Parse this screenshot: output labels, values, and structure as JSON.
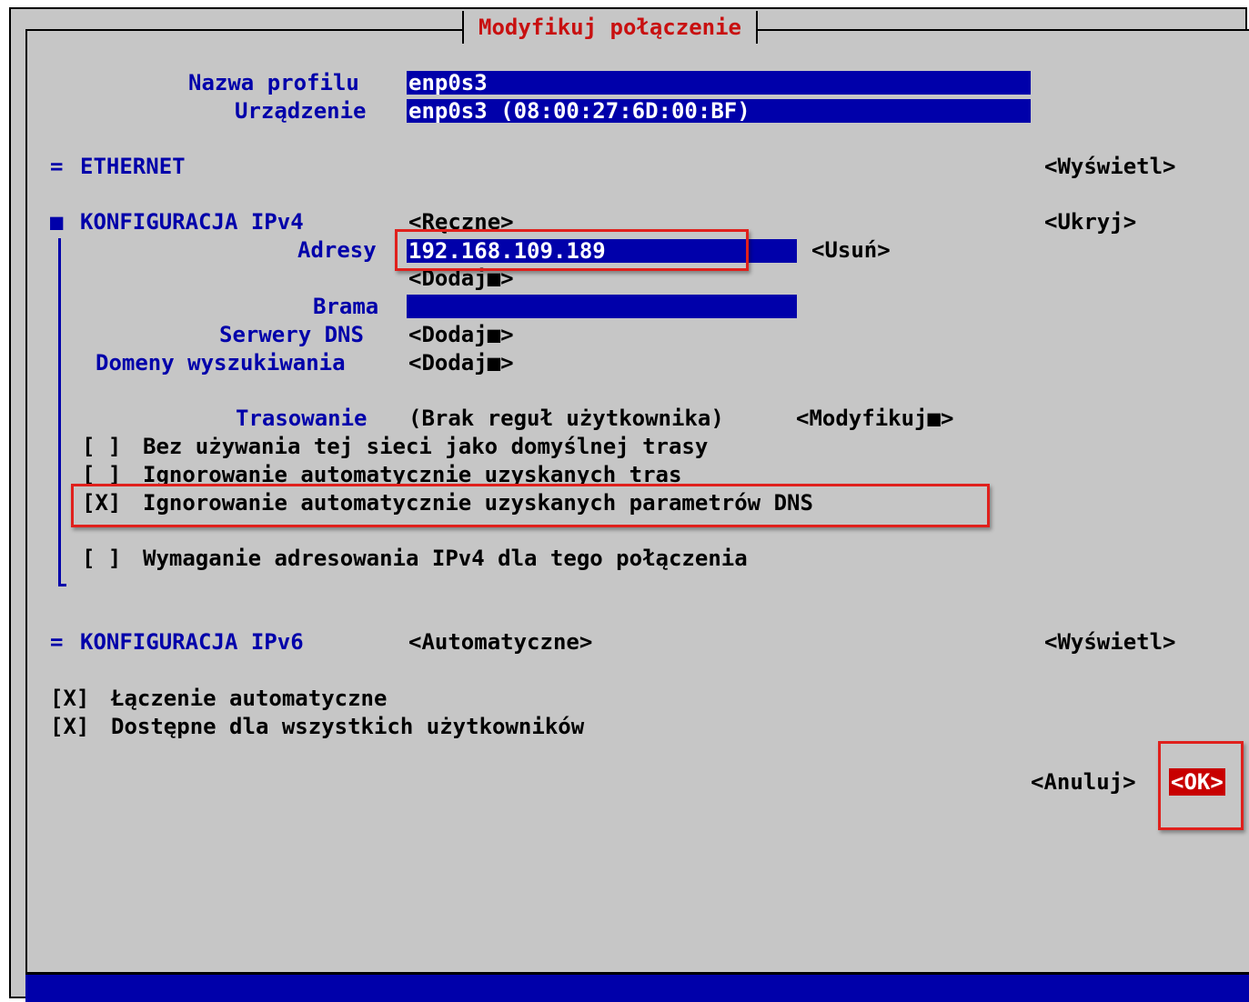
{
  "dialog": {
    "title": "Modyfikuj połączenie"
  },
  "profile": {
    "name_label": "Nazwa profilu",
    "name_value": "enp0s3",
    "device_label": "Urządzenie",
    "device_value": "enp0s3 (08:00:27:6D:00:BF)"
  },
  "ethernet": {
    "marker": "=",
    "label": "ETHERNET",
    "toggle": "<Wyświetl>"
  },
  "ipv4": {
    "marker": "■",
    "label": "KONFIGURACJA IPv4",
    "mode": "<Ręczne>",
    "toggle": "<Ukryj>",
    "addresses_label": "Adresy",
    "address_value": "192.168.109.189",
    "remove_button": "<Usuń>",
    "add_address": "<Dodaj■>",
    "gateway_label": "Brama",
    "gateway_value": "",
    "dns_label": "Serwery DNS",
    "dns_add": "<Dodaj■>",
    "search_label": "Domeny wyszukiwania",
    "search_add": "<Dodaj■>",
    "routing_label": "Trasowanie",
    "routing_value": "(Brak reguł użytkownika)",
    "routing_modify": "<Modyfikuj■>",
    "checkboxes": [
      {
        "mark": "[ ]",
        "label": "Bez używania tej sieci jako domyślnej trasy"
      },
      {
        "mark": "[ ]",
        "label": "Ignorowanie automatycznie uzyskanych tras"
      },
      {
        "mark": "[X]",
        "label": "Ignorowanie automatycznie uzyskanych parametrów DNS"
      },
      {
        "mark": "[ ]",
        "label": "Wymaganie adresowania IPv4 dla tego połączenia"
      }
    ]
  },
  "ipv6": {
    "marker": "=",
    "label": "KONFIGURACJA IPv6",
    "mode": "<Automatyczne>",
    "toggle": "<Wyświetl>"
  },
  "options": [
    {
      "mark": "[X]",
      "label": "Łączenie automatyczne"
    },
    {
      "mark": "[X]",
      "label": "Dostępne dla wszystkich użytkowników"
    }
  ],
  "buttons": {
    "cancel": "<Anuluj>",
    "ok": "<OK>"
  },
  "colors": {
    "accent_blue": "#0000aa",
    "background": "#c6c6c6",
    "title_red": "#c81010",
    "highlight_red": "#e0201c",
    "ok_bg": "#c80000"
  }
}
